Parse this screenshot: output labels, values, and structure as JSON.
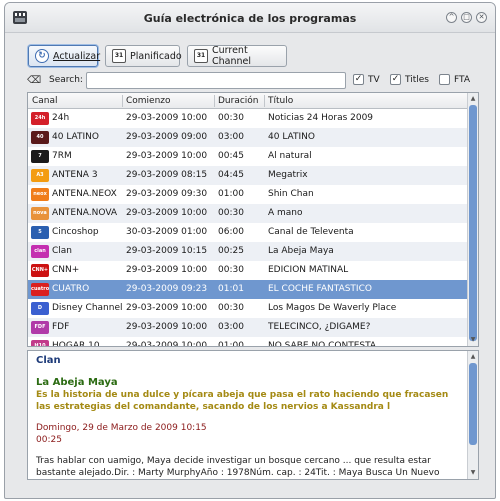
{
  "window": {
    "title": "Guía electrónica de los programas"
  },
  "toolbar": {
    "update_label": "Actualizar",
    "planned_label": "Planificado",
    "current_label": "Current Channel",
    "calendar_icon_text": "31"
  },
  "search": {
    "label": "Search:",
    "value": "",
    "placeholder": "",
    "filters": [
      {
        "label": "TV",
        "checked": true
      },
      {
        "label": "Titles",
        "checked": true
      },
      {
        "label": "FTA",
        "checked": false
      }
    ]
  },
  "table": {
    "headers": [
      "Canal",
      "Comienzo",
      "Duración",
      "Título"
    ],
    "selected_index": 9,
    "rows": [
      {
        "channel": "24h",
        "start": "29-03-2009 10:00",
        "duration": "00:30",
        "title": "Noticias 24 Horas 2009",
        "logo_text": "24h",
        "logo_color": "#d4202a"
      },
      {
        "channel": "40 LATINO",
        "start": "29-03-2009 09:00",
        "duration": "03:00",
        "title": "40 LATINO",
        "logo_text": "40",
        "logo_color": "#5a1a1a"
      },
      {
        "channel": "7RM",
        "start": "29-03-2009 10:00",
        "duration": "00:45",
        "title": "Al natural",
        "logo_text": "7",
        "logo_color": "#1a1a1a"
      },
      {
        "channel": "ANTENA 3",
        "start": "29-03-2009 08:15",
        "duration": "04:45",
        "title": "Megatrix",
        "logo_text": "A3",
        "logo_color": "#f39c12"
      },
      {
        "channel": "ANTENA.NEOX",
        "start": "29-03-2009 09:30",
        "duration": "01:00",
        "title": "Shin Chan",
        "logo_text": "neox",
        "logo_color": "#f07d1a"
      },
      {
        "channel": "ANTENA.NOVA",
        "start": "29-03-2009 10:00",
        "duration": "00:30",
        "title": "A mano",
        "logo_text": "nova",
        "logo_color": "#e8923a"
      },
      {
        "channel": "Cincoshop",
        "start": "30-03-2009 01:00",
        "duration": "06:00",
        "title": "Canal de Televenta",
        "logo_text": "5",
        "logo_color": "#2a5fb0"
      },
      {
        "channel": "Clan",
        "start": "29-03-2009 10:15",
        "duration": "00:25",
        "title": "La Abeja Maya",
        "logo_text": "clan",
        "logo_color": "#c42fb0"
      },
      {
        "channel": "CNN+",
        "start": "29-03-2009 10:00",
        "duration": "00:30",
        "title": "EDICIÓN MATINAL",
        "logo_text": "CNN+",
        "logo_color": "#cc1111"
      },
      {
        "channel": "CUATRO",
        "start": "29-03-2009 09:23",
        "duration": "01:01",
        "title": "EL COCHE FANTÁSTICO",
        "logo_text": "cuatro",
        "logo_color": "#d92020"
      },
      {
        "channel": "Disney Channel",
        "start": "29-03-2009 10:00",
        "duration": "00:30",
        "title": "Los Magos De Waverly Place",
        "logo_text": "D",
        "logo_color": "#3a5fd0"
      },
      {
        "channel": "FDF",
        "start": "29-03-2009 10:00",
        "duration": "03:00",
        "title": "TELECINCO, ¿DÍGAME?",
        "logo_text": "FDF",
        "logo_color": "#b03aa8"
      },
      {
        "channel": "HOGAR 10",
        "start": "29-03-2009 10:00",
        "duration": "01:00",
        "title": "NO SABE NO CONTESTA",
        "logo_text": "H10",
        "logo_color": "#c23a8a"
      }
    ]
  },
  "detail": {
    "channel": "Clan",
    "title": "La Abeja Maya",
    "description": "Es la historia de una dulce y pícara abeja que pasa el rato haciendo que fracasen las estrategias del comandante, sacando de los nervios a Kassandra l",
    "date": "Domingo, 29 de Marzo de 2009 10:15",
    "duration": "00:25",
    "body": "Tras hablar con uamigo, Maya decide investigar un bosque cercano ... que resulta estar bastante alejado.Dir. : Marty MurphyAño : 1978Núm. cap. : 24Tit. : Maya Busca Un Nuevo HogarTit. original :"
  }
}
